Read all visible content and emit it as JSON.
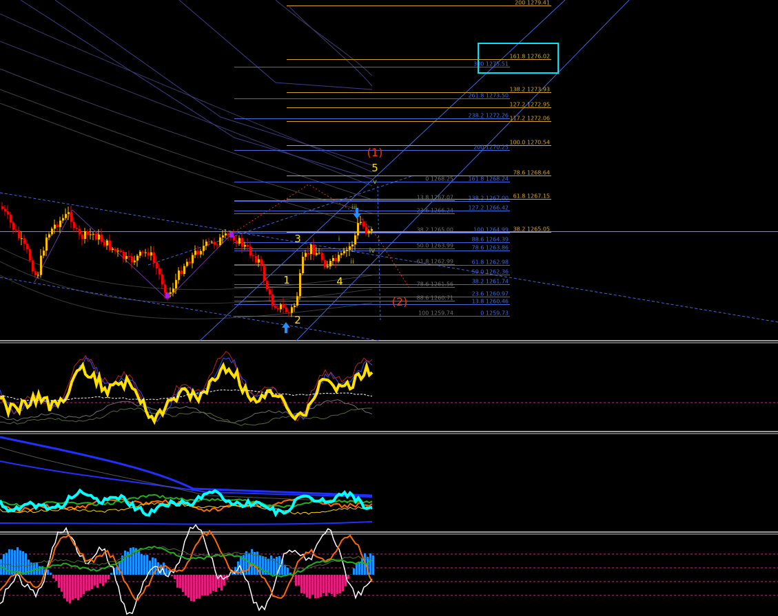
{
  "colors": {
    "background": "#000000",
    "separator": "#ffffff",
    "candle_up": "#ffbf00",
    "candle_down": "#ff0000",
    "fib_gold": "#daa520",
    "fib_blue": "#4169e1",
    "wave_yellow": "#ffe000",
    "wave_red": "#ff3000",
    "highlight_box": "#00e5ff",
    "arrow": "#1e90ff"
  },
  "icons": [
    "up-arrow-icon",
    "down-arrow-icon"
  ],
  "chart_data": [
    {
      "type": "candlestick",
      "title": "",
      "price_range": [
        1258.8,
        1281.0
      ],
      "fib_levels": [
        {
          "text": "200 1279.41",
          "price": 1279.41,
          "color": "gold",
          "line_from": "wave-5"
        },
        {
          "text": "161.8 1276.02",
          "price": 1276.02,
          "color": "gold",
          "line_from": "wave-5"
        },
        {
          "text": "300 1275.51",
          "price": 1275.51,
          "color": "blue",
          "line_from": "wave-1"
        },
        {
          "text": "138.2 1273.93",
          "price": 1273.93,
          "color": "gold",
          "line_from": "wave-5"
        },
        {
          "text": "261.8 1273.50",
          "price": 1273.5,
          "color": "blue",
          "line_from": "wave-1"
        },
        {
          "text": "127.2 1272.95",
          "price": 1272.95,
          "color": "gold",
          "line_from": "wave-5"
        },
        {
          "text": "238.2 1272.26",
          "price": 1272.26,
          "color": "blue",
          "line_from": "wave-1"
        },
        {
          "text": "117.2 1272.06",
          "price": 1272.06,
          "color": "gold",
          "line_from": "wave-5"
        },
        {
          "text": "100.0   1270.54",
          "price": 1270.54,
          "color": "gold",
          "line_from": "wave-5"
        },
        {
          "text": "200 1270.25",
          "price": 1270.25,
          "color": "blue",
          "line_from": "wave-1"
        },
        {
          "text": "0 1268.25",
          "price": 1268.25,
          "color": "grey",
          "line_from": "wave-5"
        },
        {
          "text": "161.8 1268.24",
          "price": 1268.24,
          "color": "blue",
          "line_from": "wave-1"
        },
        {
          "text": "78.6 1268.64",
          "price": 1268.64,
          "color": "gold",
          "line_from": "wave-5"
        },
        {
          "text": "13.8 1267.07",
          "price": 1267.07,
          "color": "grey",
          "line_from": "wave-1"
        },
        {
          "text": "138.2 1267.00",
          "price": 1267.0,
          "color": "blue",
          "line_from": "wave-1"
        },
        {
          "text": "61.8 1267.15",
          "price": 1267.15,
          "color": "gold",
          "line_from": "wave-5"
        },
        {
          "text": "23.6 1266.24",
          "price": 1266.24,
          "color": "grey",
          "line_from": "wave-1"
        },
        {
          "text": "127.2 1266.42",
          "price": 1266.42,
          "color": "blue",
          "line_from": "wave-1"
        },
        {
          "text": "38.2 1265.00",
          "price": 1265.0,
          "color": "grey",
          "line_from": "wave-1"
        },
        {
          "text": "100 1264.99",
          "price": 1264.99,
          "color": "blue",
          "line_from": "wave-1"
        },
        {
          "text": "38.2 1265.05",
          "price": 1265.05,
          "color": "gold",
          "line_from": "wave-5"
        },
        {
          "text": "88.6 1264.39",
          "price": 1264.39,
          "color": "blue",
          "line_from": "wave-1"
        },
        {
          "text": "50.0 1263.99",
          "price": 1263.99,
          "color": "grey",
          "line_from": "wave-1"
        },
        {
          "text": "78.6 1263.86",
          "price": 1263.86,
          "color": "blue",
          "line_from": "wave-1"
        },
        {
          "text": "61.8 1262.99",
          "price": 1262.99,
          "color": "grey",
          "line_from": "wave-1"
        },
        {
          "text": "61.8 1262.98",
          "price": 1262.98,
          "color": "blue",
          "line_from": "wave-1"
        },
        {
          "text": "50.0 1262.36",
          "price": 1262.36,
          "color": "blue",
          "line_from": "wave-1"
        },
        {
          "text": "78.6 1261.56",
          "price": 1261.56,
          "color": "grey",
          "line_from": "wave-1"
        },
        {
          "text": "38.2 1261.74",
          "price": 1261.74,
          "color": "blue",
          "line_from": "wave-1"
        },
        {
          "text": "23.6 1260.97",
          "price": 1260.97,
          "color": "blue",
          "line_from": "wave-1"
        },
        {
          "text": "88.6 1260.71",
          "price": 1260.71,
          "color": "grey",
          "line_from": "wave-1"
        },
        {
          "text": "13.8 1260.46",
          "price": 1260.46,
          "color": "blue",
          "line_from": "wave-1"
        },
        {
          "text": "100 1259.74",
          "price": 1259.74,
          "color": "grey",
          "line_from": "wave-1"
        },
        {
          "text": "0 1259.73",
          "price": 1259.73,
          "color": "blue",
          "line_from": "wave-1"
        }
      ],
      "highlighted_level": "161.8 1276.02",
      "current_price": 1265.1,
      "wave_labels": [
        {
          "text": "1",
          "color": "yellow"
        },
        {
          "text": "2",
          "color": "yellow"
        },
        {
          "text": "3",
          "color": "yellow"
        },
        {
          "text": "4",
          "color": "yellow"
        },
        {
          "text": "5",
          "color": "yellow"
        },
        {
          "text": "(1)",
          "color": "red"
        },
        {
          "text": "(2)",
          "color": "red"
        },
        {
          "text": "i",
          "color": "olive"
        },
        {
          "text": "ii",
          "color": "olive"
        },
        {
          "text": "iii",
          "color": "olive"
        },
        {
          "text": "iv",
          "color": "olive"
        },
        {
          "text": "v",
          "color": "olive"
        }
      ]
    },
    {
      "type": "line",
      "title": "",
      "description_series": [
        "oscillator (yellow)",
        "signal (white dashed)",
        "bands"
      ]
    },
    {
      "type": "line",
      "title": "",
      "description_series": [
        "cyan",
        "orange",
        "green",
        "blue"
      ]
    },
    {
      "type": "bar",
      "title": "",
      "description_series": [
        "histogram blue/magenta",
        "orange",
        "white",
        "green"
      ]
    }
  ]
}
